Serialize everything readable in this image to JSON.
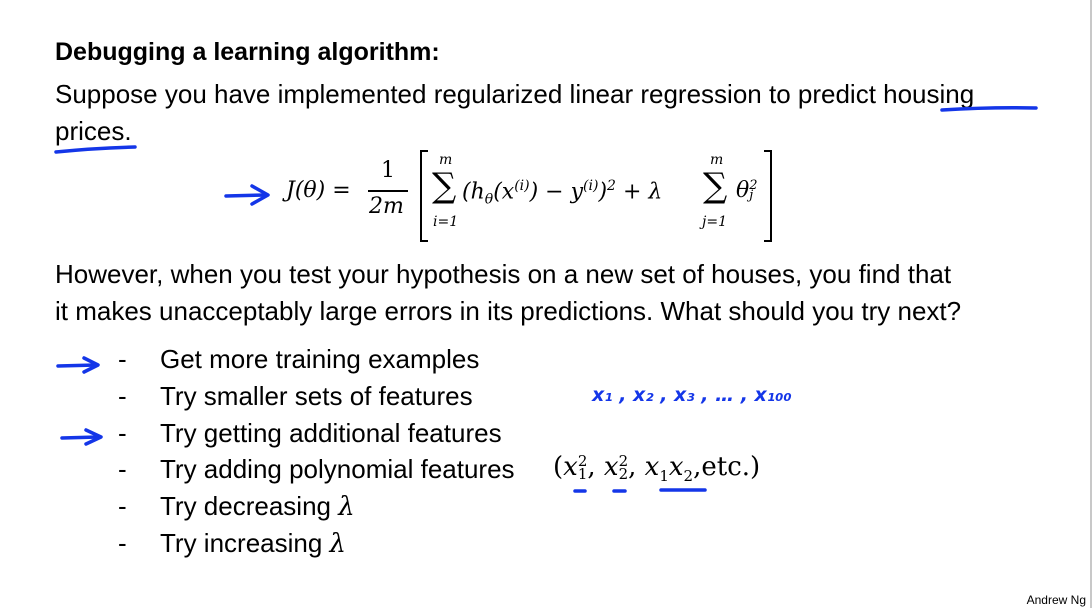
{
  "slide": {
    "title": "Debugging a learning algorithm:",
    "intro_line1_prefix": "Suppose you have implemented regularized linear regression to predict ",
    "intro_line1_emph": "housing",
    "intro_line2": "prices.",
    "formula": {
      "lhs": "J(θ) =",
      "frac_num": "1",
      "frac_den": "2m",
      "sum1_top": "m",
      "sum1_bottom": "i=1",
      "sum_symbol": "∑",
      "term": "(h",
      "term_sub": "θ",
      "term2": "(x",
      "term2_sup": "(i)",
      "term3": ") − y",
      "term3_sup": "(i)",
      "term4": ")",
      "term4_sup": "2",
      "plus_lambda": " + λ",
      "sum2_top": "m",
      "sum2_bottom": "j=1",
      "theta": "θ",
      "theta_sup": "2",
      "theta_sub": "j"
    },
    "paragraph_line1": "However, when you test your hypothesis on a new set of houses, you find that",
    "paragraph_line2": "it makes unacceptably large errors in its predictions. What should you try next?",
    "options": [
      {
        "dash": "-",
        "text": "Get more training examples",
        "annotated": true
      },
      {
        "dash": "-",
        "text": "Try smaller sets of features",
        "annotated": false
      },
      {
        "dash": "-",
        "text": "Try getting additional features",
        "annotated": true
      },
      {
        "dash": "-",
        "text": "Try adding polynomial features",
        "annotated": false
      },
      {
        "dash": "-",
        "text": "Try decreasing ",
        "lambda": "λ",
        "annotated": false
      },
      {
        "dash": "-",
        "text": "Try increasing ",
        "lambda": "λ",
        "annotated": false
      }
    ],
    "polynomial_example": {
      "open": "(",
      "x": "x",
      "one": "1",
      "two": "2",
      "sq": "2",
      "comma": ", ",
      "etc": ",etc.)"
    },
    "handwritten_features": "x₁ , x₂ , x₃ , … , x₁₀₀",
    "footer": "Andrew Ng"
  },
  "annotation_color": "#1436e8"
}
